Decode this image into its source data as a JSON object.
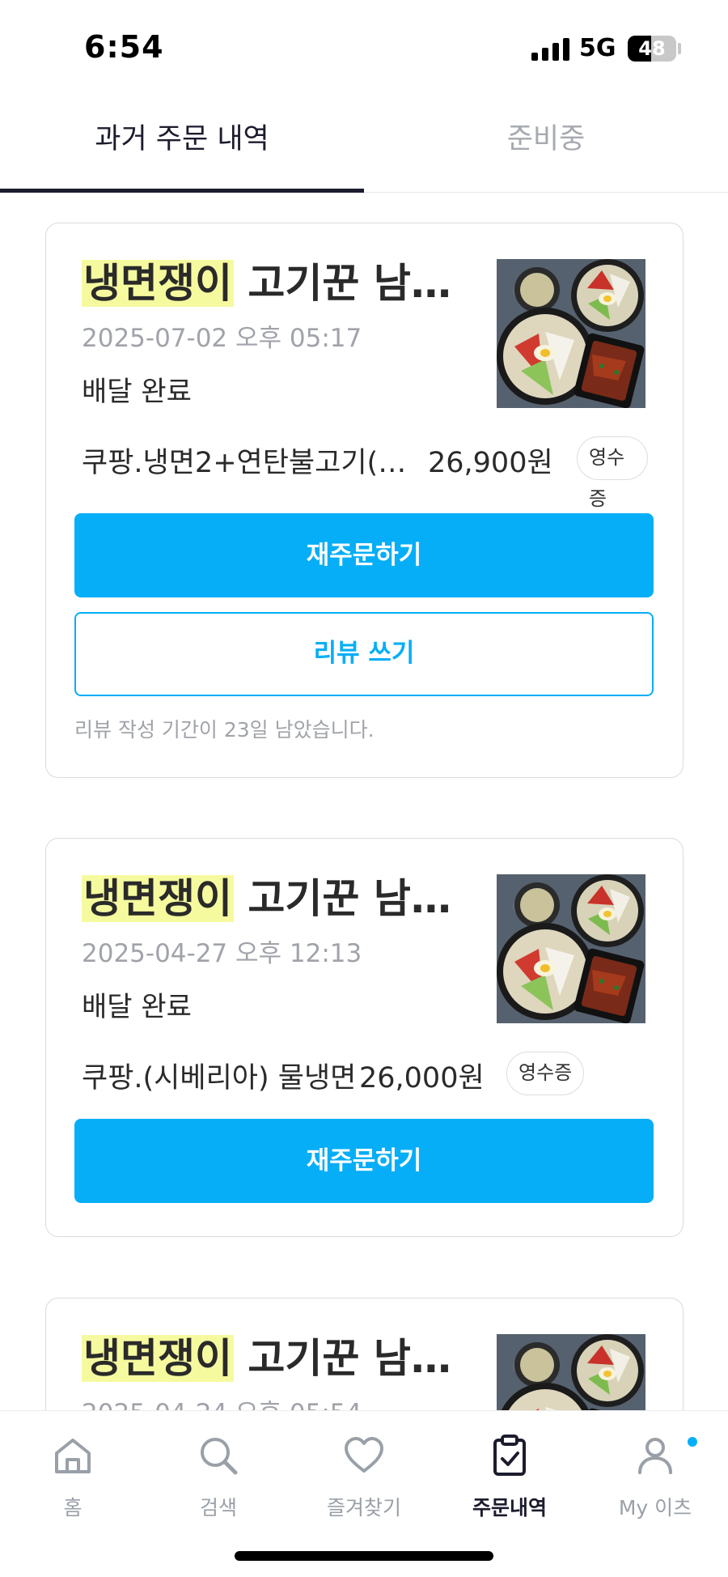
{
  "status_bar": {
    "time": "6:54",
    "network": "5G",
    "battery": "48",
    "battery_level": 0.48
  },
  "tabs": [
    {
      "label": "과거 주문 내역",
      "active": true
    },
    {
      "label": "준비중",
      "active": false
    }
  ],
  "orders": [
    {
      "store_highlight": "냉면쟁이",
      "store_rest": " 고기꾼 남…",
      "date": "2025-07-02 오후 05:17",
      "status": "배달 완료",
      "item": "쿠팡.냉면2+연탄불고기(1...",
      "price": "26,900원",
      "receipt_label": "영수증",
      "reorder_label": "재주문하기",
      "review_label": "리뷰 쓰기",
      "review_note": "리뷰 작성 기간이 23일 남았습니다."
    },
    {
      "store_highlight": "냉면쟁이",
      "store_rest": " 고기꾼 남…",
      "date": "2025-04-27 오후 12:13",
      "status": "배달 완료",
      "item": "쿠팡.(시베리아) 물냉면",
      "price": "26,000원",
      "receipt_label": "영수증",
      "reorder_label": "재주문하기"
    },
    {
      "store_highlight": "냉면쟁이",
      "store_rest": " 고기꾼 남…",
      "date": "2025-04-24 오후 05:54"
    }
  ],
  "bottom_nav": [
    {
      "label": "홈",
      "icon": "home-icon"
    },
    {
      "label": "검색",
      "icon": "search-icon"
    },
    {
      "label": "즐겨찾기",
      "icon": "heart-icon"
    },
    {
      "label": "주문내역",
      "icon": "clipboard-check-icon",
      "active": true
    },
    {
      "label": "My 이츠",
      "icon": "person-icon",
      "badge": true
    }
  ],
  "colors": {
    "accent": "#06aef7",
    "highlight": "#f6fa9f",
    "text_dark": "#1c1c2e",
    "text_muted": "#a0a3a9"
  }
}
